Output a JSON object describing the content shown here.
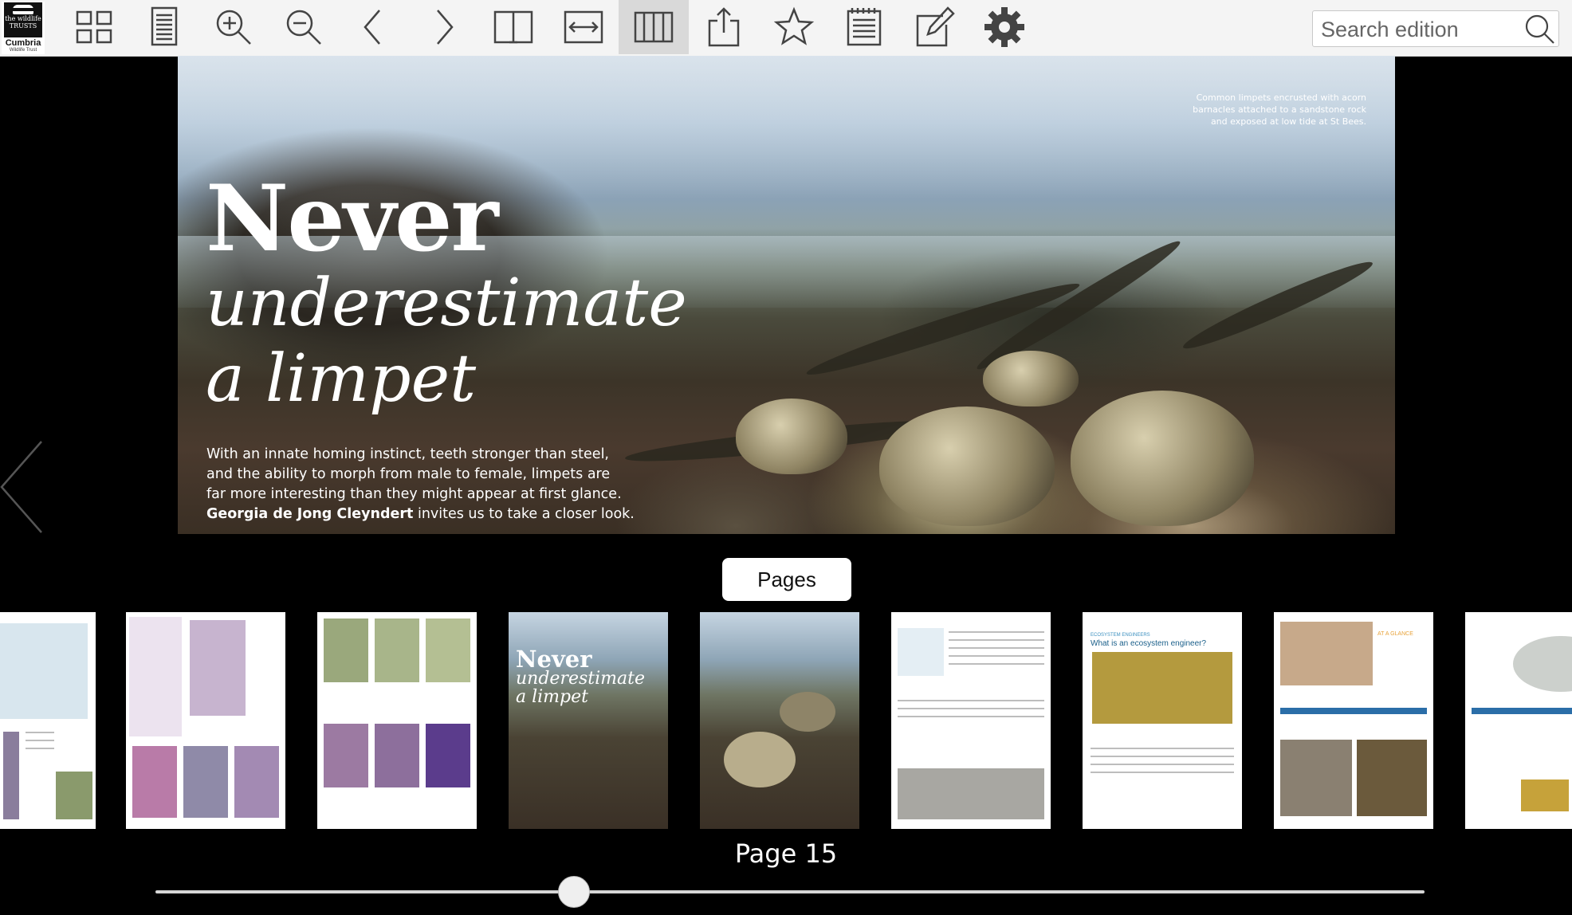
{
  "toolbar": {
    "logo": {
      "line1": "the wildlife",
      "line2": "TRUSTS",
      "name": "Cumbria",
      "sub": "Wildlife Trust"
    },
    "tools": [
      "thumbnails-grid-icon",
      "single-page-icon",
      "zoom-in-icon",
      "zoom-out-icon",
      "previous-icon",
      "next-icon",
      "two-page-spread-icon",
      "fit-width-icon",
      "page-strip-icon",
      "share-icon",
      "bookmark-star-icon",
      "notes-icon",
      "edit-icon",
      "settings-gear-icon"
    ],
    "active_tool": "page-strip-icon",
    "search_placeholder": "Search edition"
  },
  "article": {
    "headline_line1": "Never",
    "headline_line2": "underestimate",
    "headline_line3": "a limpet",
    "standfirst_lines": [
      "With an innate homing instinct, teeth stronger than steel,",
      "and the ability to morph from male to female, limpets are",
      "far more interesting than they might appear at first glance."
    ],
    "byline_name": "Georgia de Jong Cleyndert",
    "byline_rest": " invites us to take a closer look.",
    "caption_lines": [
      "Common limpets encrusted with acorn",
      "barnacles attached to a sandstone rock",
      "and exposed at low tide at St Bees."
    ]
  },
  "pages_panel": {
    "button_label": "Pages",
    "current_page_label": "Page 15",
    "slider_fraction": 0.33,
    "thumbnail_cover": {
      "line1": "Never",
      "line2": "underestimate",
      "line3": "a limpet"
    },
    "thumbnail_headings": {
      "engineer_kicker": "ECOSYSTEM ENGINEERS",
      "engineer_title": "What is an ecosystem engineer?",
      "glance": "AT A GLANCE"
    }
  }
}
